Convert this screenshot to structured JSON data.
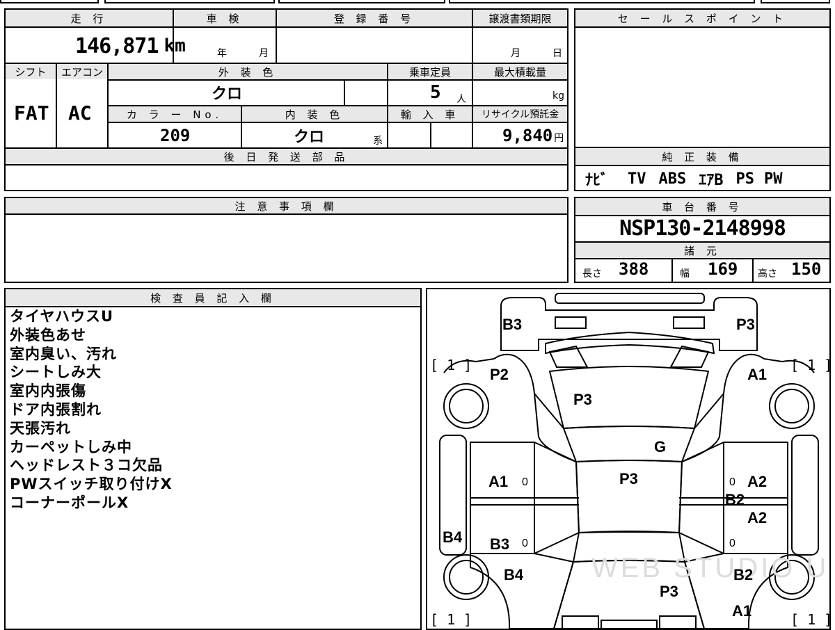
{
  "sheet": {
    "mileage": {
      "label": "走 行",
      "value": "146,871",
      "unit": "km"
    },
    "inspection": {
      "label": "車 検",
      "year_unit": "年",
      "month_unit": "月"
    },
    "registration": {
      "label": "登 録 番 号",
      "value": ""
    },
    "transfer_deadline": {
      "label": "譲渡書類期限",
      "month_unit": "月",
      "day_unit": "日"
    },
    "shift": {
      "label": "シフト",
      "value": "FAT"
    },
    "aircon": {
      "label": "エアコン",
      "value": "AC"
    },
    "exterior_color": {
      "label": "外 装 色",
      "value": "クロ"
    },
    "capacity": {
      "label": "乗車定員",
      "value": "5",
      "unit": "人"
    },
    "max_load": {
      "label": "最大積載量",
      "unit": "kg"
    },
    "color_no": {
      "label": "カ ラ ー No.",
      "value": "209"
    },
    "interior_color": {
      "label": "内 装 色",
      "value": "クロ",
      "suffix": "系"
    },
    "import": {
      "label": "輸 入 車"
    },
    "recycle_fee": {
      "label": "リサイクル預託金",
      "value": "9,840",
      "unit": "円"
    },
    "later_parts": {
      "label": "後 日 発 送 部 品"
    },
    "sales_point": {
      "label": "セ ー ル ス ポ イ ン ト"
    },
    "genuine_equipment": {
      "label": "純 正 装 備",
      "items": [
        "ﾅﾋﾞ",
        "TV",
        "ABS",
        "ｴｱB",
        "PS",
        "PW"
      ]
    },
    "caution": {
      "label": "注 意 事 項 欄"
    },
    "chassis_no": {
      "label": "車 台 番 号",
      "value": "NSP130-2148998"
    },
    "specs": {
      "label": "諸 元",
      "length": {
        "label": "長さ",
        "value": "388"
      },
      "width": {
        "label": "幅",
        "value": "169"
      },
      "height": {
        "label": "高さ",
        "value": "150"
      }
    },
    "inspector": {
      "label": "検 査 員 記 入 欄",
      "notes": [
        "タイヤハウスU",
        "外装色あせ",
        "室内臭い、汚れ",
        "シートしみ大",
        "室内内張傷",
        "ドア内張割れ",
        "天張汚れ",
        "カーペットしみ中",
        "ヘッドレスト３コ欠品",
        "PWスイッチ取り付けX",
        "コーナーポールX"
      ]
    }
  },
  "diagram": {
    "tire_marks": {
      "front_left": "[ 1 ]",
      "front_right": "[ 1 ]",
      "rear_left": "[ 1 ]",
      "rear_right": "[ 1 ]"
    },
    "damage": {
      "front_bumper_left": "B3",
      "front_bumper_right": "P3",
      "left_front_fender": "P2",
      "right_front_fender": "A1",
      "bonnet": "P3",
      "windshield": "G",
      "roof": "P3",
      "left_front_door": "A1",
      "left_front_door_zero": "0",
      "right_front_door_zero": "0",
      "right_front_door": "A2",
      "right_pillar": "B2",
      "right_rear_door": "A2",
      "right_rear_door_zero": "0",
      "left_rocker": "B4",
      "left_rear_door": "B3",
      "left_rear_door_zero": "0",
      "left_rear_fender": "B4",
      "right_rear_fender": "B2",
      "trunk": "P3",
      "rear_bumper_right": "A1"
    },
    "watermark": "WEB STUDIO U"
  }
}
